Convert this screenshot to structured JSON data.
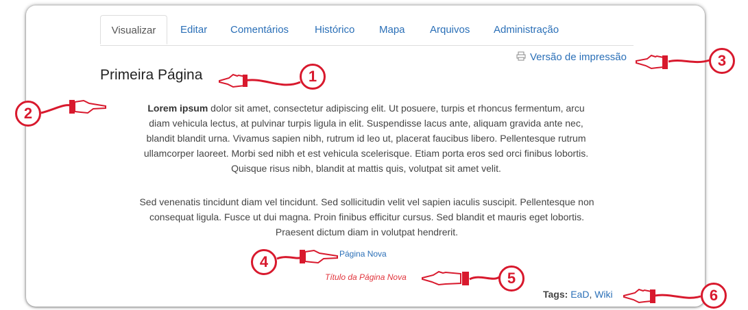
{
  "tabs": [
    {
      "label": "Visualizar",
      "active": true
    },
    {
      "label": "Editar"
    },
    {
      "label": "Comentários"
    },
    {
      "label": "Histórico"
    },
    {
      "label": "Mapa"
    },
    {
      "label": "Arquivos"
    },
    {
      "label": "Administração"
    }
  ],
  "print_link": {
    "label": "Versão de impressão",
    "icon": "printer-icon"
  },
  "page": {
    "title": "Primeira Página",
    "paragraph1": {
      "bold": "Lorem ipsum",
      "lines": [
        " dolor sit amet, consectetur adipiscing elit. Ut posuere, turpis et rhoncus fermentum, arcu",
        "diam vehicula lectus, at pulvinar turpis ligula in elit. Suspendisse lacus ante, aliquam gravida ante nec,",
        "blandit blandit urna. Vivamus sapien nibh, rutrum id leo ut, placerat faucibus libero. Pellentesque rutrum",
        "ullamcorper laoreet. Morbi sed nibh et est vehicula scelerisque. Etiam porta eros sed orci finibus lobortis.",
        "Quisque risus nibh, blandit at mattis quis, volutpat sit amet velit."
      ]
    },
    "paragraph2": {
      "lines": [
        "Sed venenatis tincidunt diam vel tincidunt. Sed sollicitudin velit vel sapien iaculis suscipit. Pellentesque non",
        "consequat ligula. Fusce ut dui magna. Proin finibus efficitur cursus. Sed blandit et mauris eget lobortis.",
        "Praesent dictum diam in volutpat hendrerit."
      ]
    },
    "link_existing": "Página Nova",
    "link_missing": "Título da Página Nova",
    "tags": {
      "label": "Tags:",
      "items": [
        "EaD",
        "Wiki"
      ],
      "separator": ", "
    }
  },
  "annotations": [
    "1",
    "2",
    "3",
    "4",
    "5",
    "6"
  ],
  "colors": {
    "link": "#2a6fb7",
    "missing_link": "#e1343c",
    "annotation": "#d8192d"
  }
}
